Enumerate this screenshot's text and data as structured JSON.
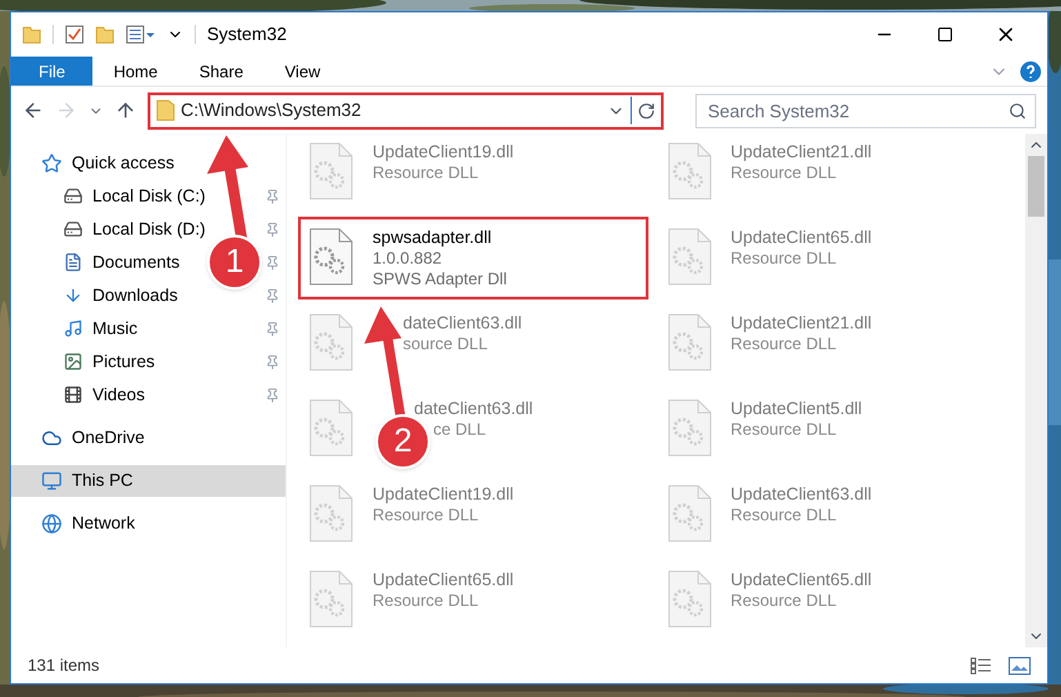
{
  "window": {
    "title": "System32"
  },
  "ribbon": {
    "tabs": [
      {
        "label": "File",
        "kind": "file",
        "selected": false
      },
      {
        "label": "Home",
        "kind": "tab",
        "selected": false
      },
      {
        "label": "Share",
        "kind": "tab",
        "selected": false
      },
      {
        "label": "View",
        "kind": "tab",
        "selected": false
      }
    ]
  },
  "address_bar": {
    "path": "C:\\Windows\\System32",
    "highlighted": true
  },
  "search": {
    "placeholder": "Search System32"
  },
  "sidebar": {
    "items": [
      {
        "label": "Quick access",
        "selected": false,
        "children": [
          {
            "label": "Local Disk (C:)",
            "pinned": true,
            "selected": false
          },
          {
            "label": "Local Disk (D:)",
            "pinned": true,
            "selected": false
          },
          {
            "label": "Documents",
            "pinned": true,
            "selected": false
          },
          {
            "label": "Downloads",
            "pinned": true,
            "selected": false
          },
          {
            "label": "Music",
            "pinned": true,
            "selected": false
          },
          {
            "label": "Pictures",
            "pinned": true,
            "selected": false
          },
          {
            "label": "Videos",
            "pinned": true,
            "selected": false
          }
        ]
      },
      {
        "label": "OneDrive",
        "selected": false
      },
      {
        "label": "This PC",
        "selected": true
      },
      {
        "label": "Network",
        "selected": false
      }
    ]
  },
  "files": [
    {
      "name": "UpdateClient19.dll",
      "details": [
        "Resource DLL"
      ],
      "faded": true,
      "highlighted": false
    },
    {
      "name": "UpdateClient21.dll",
      "details": [
        "Resource DLL"
      ],
      "faded": true,
      "highlighted": false
    },
    {
      "name": "spwsadapter.dll",
      "details": [
        "1.0.0.882",
        "SPWS Adapter Dll"
      ],
      "faded": false,
      "highlighted": true
    },
    {
      "name": "UpdateClient65.dll",
      "details": [
        "Resource DLL"
      ],
      "faded": true,
      "highlighted": false
    },
    {
      "name": "dateClient63.dll",
      "details": [
        "source DLL"
      ],
      "faded": true,
      "highlighted": false
    },
    {
      "name": "UpdateClient21.dll",
      "details": [
        "Resource DLL"
      ],
      "faded": true,
      "highlighted": false
    },
    {
      "name": "dateClient63.dll",
      "details": [
        "ce DLL"
      ],
      "faded": true,
      "highlighted": false
    },
    {
      "name": "UpdateClient5.dll",
      "details": [
        "Resource DLL"
      ],
      "faded": true,
      "highlighted": false
    },
    {
      "name": "UpdateClient19.dll",
      "details": [
        "Resource DLL"
      ],
      "faded": true,
      "highlighted": false
    },
    {
      "name": "UpdateClient63.dll",
      "details": [
        "Resource DLL"
      ],
      "faded": true,
      "highlighted": false
    },
    {
      "name": "UpdateClient65.dll",
      "details": [
        "Resource DLL"
      ],
      "faded": true,
      "highlighted": false
    },
    {
      "name": "UpdateClient65.dll",
      "details": [
        "Resource DLL"
      ],
      "faded": true,
      "highlighted": false
    }
  ],
  "status_bar": {
    "item_count": "131 items"
  },
  "annotations": [
    {
      "number": "1"
    },
    {
      "number": "2"
    }
  ]
}
